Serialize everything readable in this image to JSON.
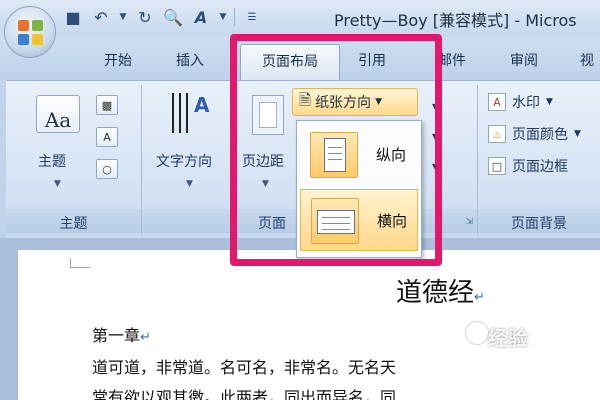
{
  "window": {
    "title": "Pretty—Boy [兼容模式] - Micros"
  },
  "quick_access": {
    "icons": [
      "save-icon",
      "undo-icon",
      "redo-icon",
      "print-preview-icon",
      "spelling-icon",
      "customize-icon"
    ]
  },
  "tabs": [
    {
      "label": "开始"
    },
    {
      "label": "插入"
    },
    {
      "label": "页面布局"
    },
    {
      "label": "引用"
    },
    {
      "label": "邮件"
    },
    {
      "label": "审阅"
    },
    {
      "label": "视"
    }
  ],
  "ribbon": {
    "groups": {
      "theme": {
        "label": "主题",
        "button": "主题"
      },
      "page_setup": {
        "label": "页面",
        "text_direction": "文字方向",
        "margins": "页边距"
      },
      "page_background": {
        "label": "页面背景",
        "watermark": "水印",
        "page_color": "页面颜色",
        "page_border": "页面边框"
      }
    },
    "orientation_button": "纸张方向",
    "orientation_menu": [
      {
        "label": "纵向",
        "icon": "portrait-page-icon"
      },
      {
        "label": "横向",
        "icon": "landscape-page-icon"
      }
    ]
  },
  "document": {
    "title": "道德经",
    "chapter": "第一章",
    "line1": "道可道，非常道。名可名，非常名。无名天",
    "line2": "常有欲以观其徼。此两者，同出而异名，同"
  },
  "watermark": {
    "text": "经验"
  },
  "colors": {
    "highlight_frame": "#e5176c",
    "hover_item": "#ffd68a",
    "ribbon_bg": "#dbe7f5"
  }
}
